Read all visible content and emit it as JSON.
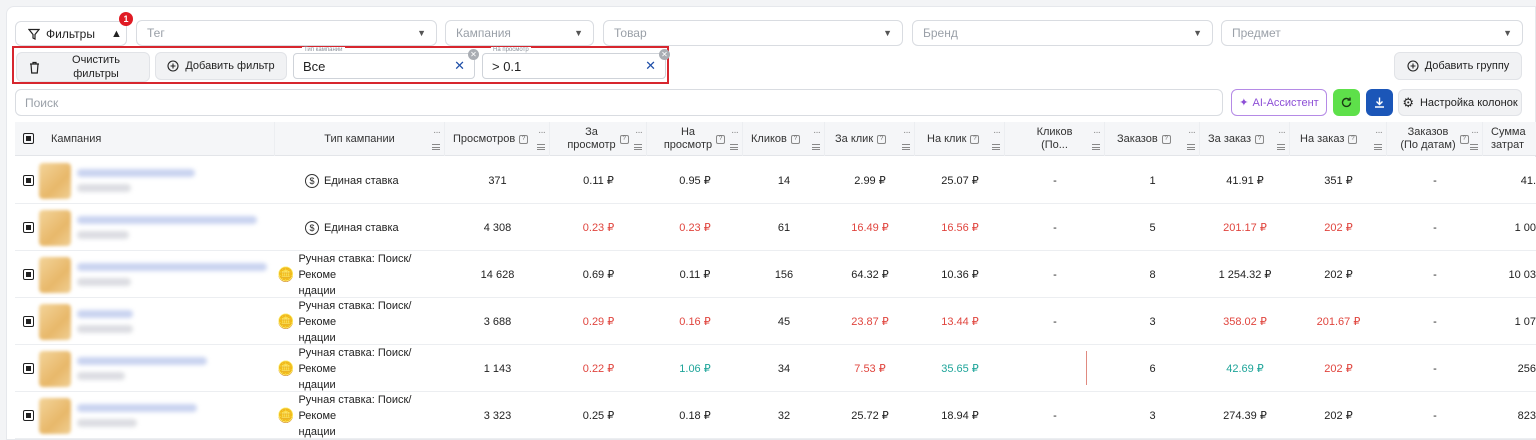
{
  "toolbar": {
    "filters_label": "Фильтры",
    "filters_badge": "1",
    "selects": [
      {
        "placeholder": "Тег"
      },
      {
        "placeholder": "Кампания"
      },
      {
        "placeholder": "Товар"
      },
      {
        "placeholder": "Бренд"
      },
      {
        "placeholder": "Предмет"
      }
    ]
  },
  "filter_bar": {
    "clear_label_line1": "Очистить",
    "clear_label_line2": "фильтры",
    "add_filter_label": "Добавить фильтр",
    "chips": [
      {
        "caption": "Тип кампании",
        "value": "Все"
      },
      {
        "caption": "На просмотр",
        "value": "> 0.1"
      }
    ],
    "add_group_label": "Добавить группу"
  },
  "search": {
    "placeholder": "Поиск"
  },
  "actions": {
    "ai_label": "AI-Ассистент",
    "columns_label": "Настройка колонок"
  },
  "table": {
    "columns": [
      {
        "l1": "Кампания",
        "l2": ""
      },
      {
        "l1": "Тип кампании",
        "l2": ""
      },
      {
        "l1": "Просмотров",
        "l2": ""
      },
      {
        "l1": "За",
        "l2": "просмотр"
      },
      {
        "l1": "На",
        "l2": "просмотр"
      },
      {
        "l1": "Кликов",
        "l2": ""
      },
      {
        "l1": "За клик",
        "l2": ""
      },
      {
        "l1": "На клик",
        "l2": ""
      },
      {
        "l1": "Кликов",
        "l2": "(По..."
      },
      {
        "l1": "Заказов",
        "l2": ""
      },
      {
        "l1": "За заказ",
        "l2": ""
      },
      {
        "l1": "На заказ",
        "l2": ""
      },
      {
        "l1": "Заказов",
        "l2": "(По датам)"
      },
      {
        "l1": "Сумма",
        "l2": "затрат"
      }
    ],
    "rows": [
      {
        "type_l1": "Единая ставка",
        "type_l2": "",
        "type_icon": "dollar-coin-icon",
        "views": "371",
        "per_view": "0.11 ₽",
        "per_view_c": "",
        "on_view": "0.95 ₽",
        "on_view_c": "",
        "clicks": "14",
        "per_click": "2.99 ₽",
        "per_click_c": "",
        "on_click": "25.07 ₽",
        "on_click_c": "",
        "clicks_by": "-",
        "orders": "1",
        "per_order": "41.91 ₽",
        "per_order_c": "",
        "on_order": "351 ₽",
        "on_order_c": "",
        "orders_by": "-",
        "spend": "41."
      },
      {
        "type_l1": "Единая ставка",
        "type_l2": "",
        "type_icon": "dollar-coin-icon",
        "views": "4 308",
        "per_view": "0.23 ₽",
        "per_view_c": "red",
        "on_view": "0.23 ₽",
        "on_view_c": "red",
        "clicks": "61",
        "per_click": "16.49 ₽",
        "per_click_c": "red",
        "on_click": "16.56 ₽",
        "on_click_c": "red",
        "clicks_by": "-",
        "orders": "5",
        "per_order": "201.17 ₽",
        "per_order_c": "red",
        "on_order": "202 ₽",
        "on_order_c": "red",
        "orders_by": "-",
        "spend": "1 00"
      },
      {
        "type_l1": "Ручная ставка: Поиск/Рекоме",
        "type_l2": "ндации",
        "type_icon": "hand-coin-icon",
        "views": "14 628",
        "per_view": "0.69 ₽",
        "per_view_c": "",
        "on_view": "0.11 ₽",
        "on_view_c": "",
        "clicks": "156",
        "per_click": "64.32 ₽",
        "per_click_c": "",
        "on_click": "10.36 ₽",
        "on_click_c": "",
        "clicks_by": "-",
        "orders": "8",
        "per_order": "1 254.32 ₽",
        "per_order_c": "",
        "on_order": "202 ₽",
        "on_order_c": "",
        "orders_by": "-",
        "spend": "10 03"
      },
      {
        "type_l1": "Ручная ставка: Поиск/Рекоме",
        "type_l2": "ндации",
        "type_icon": "hand-coin-icon",
        "views": "3 688",
        "per_view": "0.29 ₽",
        "per_view_c": "red",
        "on_view": "0.16 ₽",
        "on_view_c": "red",
        "clicks": "45",
        "per_click": "23.87 ₽",
        "per_click_c": "red",
        "on_click": "13.44 ₽",
        "on_click_c": "red",
        "clicks_by": "-",
        "orders": "3",
        "per_order": "358.02 ₽",
        "per_order_c": "red",
        "on_order": "201.67 ₽",
        "on_order_c": "red",
        "orders_by": "-",
        "spend": "1 07"
      },
      {
        "type_l1": "Ручная ставка: Поиск/Рекоме",
        "type_l2": "ндации",
        "type_icon": "hand-coin-icon",
        "views": "1 143",
        "per_view": "0.22 ₽",
        "per_view_c": "red",
        "on_view": "1.06 ₽",
        "on_view_c": "green",
        "clicks": "34",
        "per_click": "7.53 ₽",
        "per_click_c": "red",
        "on_click": "35.65 ₽",
        "on_click_c": "green",
        "clicks_by": "",
        "orders": "6",
        "per_order": "42.69 ₽",
        "per_order_c": "green",
        "on_order": "202 ₽",
        "on_order_c": "red",
        "orders_by": "-",
        "spend": "256"
      },
      {
        "type_l1": "Ручная ставка: Поиск/Рекоме",
        "type_l2": "ндации",
        "type_icon": "hand-coin-icon",
        "views": "3 323",
        "per_view": "0.25 ₽",
        "per_view_c": "",
        "on_view": "0.18 ₽",
        "on_view_c": "",
        "clicks": "32",
        "per_click": "25.72 ₽",
        "per_click_c": "",
        "on_click": "18.94 ₽",
        "on_click_c": "",
        "clicks_by": "-",
        "orders": "3",
        "per_order": "274.39 ₽",
        "per_order_c": "",
        "on_order": "202 ₽",
        "on_order_c": "",
        "orders_by": "-",
        "spend": "823"
      }
    ]
  },
  "colors": {
    "accent_red": "#e0453e",
    "accent_green": "#1fa59a",
    "ai_purple": "#8d4fd6",
    "refresh_green": "#5ee04a",
    "download_blue": "#1b56b8"
  }
}
